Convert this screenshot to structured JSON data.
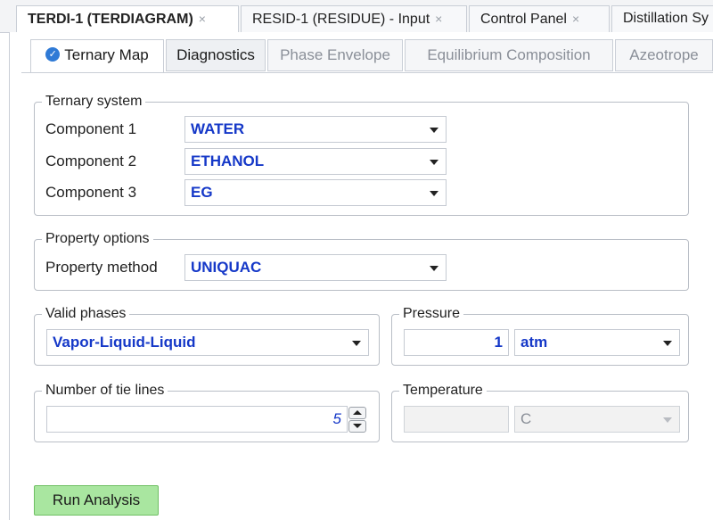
{
  "doc_tabs": [
    {
      "label": "TERDI-1 (TERDIAGRAM)",
      "close": "×"
    },
    {
      "label": "RESID-1 (RESIDUE) - Input",
      "close": "×"
    },
    {
      "label": "Control Panel",
      "close": "×"
    },
    {
      "label": "Distillation Sy",
      "close": ""
    }
  ],
  "sub_tabs": [
    {
      "label": "Ternary Map",
      "icon": "check-circle-icon"
    },
    {
      "label": "Diagnostics"
    },
    {
      "label": "Phase Envelope"
    },
    {
      "label": "Equilibrium Composition"
    },
    {
      "label": "Azeotrope"
    }
  ],
  "ternary": {
    "title": "Ternary system",
    "rows": [
      {
        "label": "Component 1",
        "value": "WATER"
      },
      {
        "label": "Component 2",
        "value": "ETHANOL"
      },
      {
        "label": "Component 3",
        "value": "EG"
      }
    ]
  },
  "property": {
    "title": "Property options",
    "label": "Property method",
    "value": "UNIQUAC"
  },
  "phases": {
    "title": "Valid phases",
    "value": "Vapor-Liquid-Liquid"
  },
  "pressure": {
    "title": "Pressure",
    "value": "1",
    "unit": "atm"
  },
  "tie_lines": {
    "title": "Number of tie lines",
    "value": "5"
  },
  "temperature": {
    "title": "Temperature",
    "value": "",
    "unit": "C"
  },
  "run_button": "Run Analysis",
  "colors": {
    "value_blue": "#1538c8",
    "run_green": "#a9e6a0",
    "check_blue": "#2f7ad6"
  }
}
